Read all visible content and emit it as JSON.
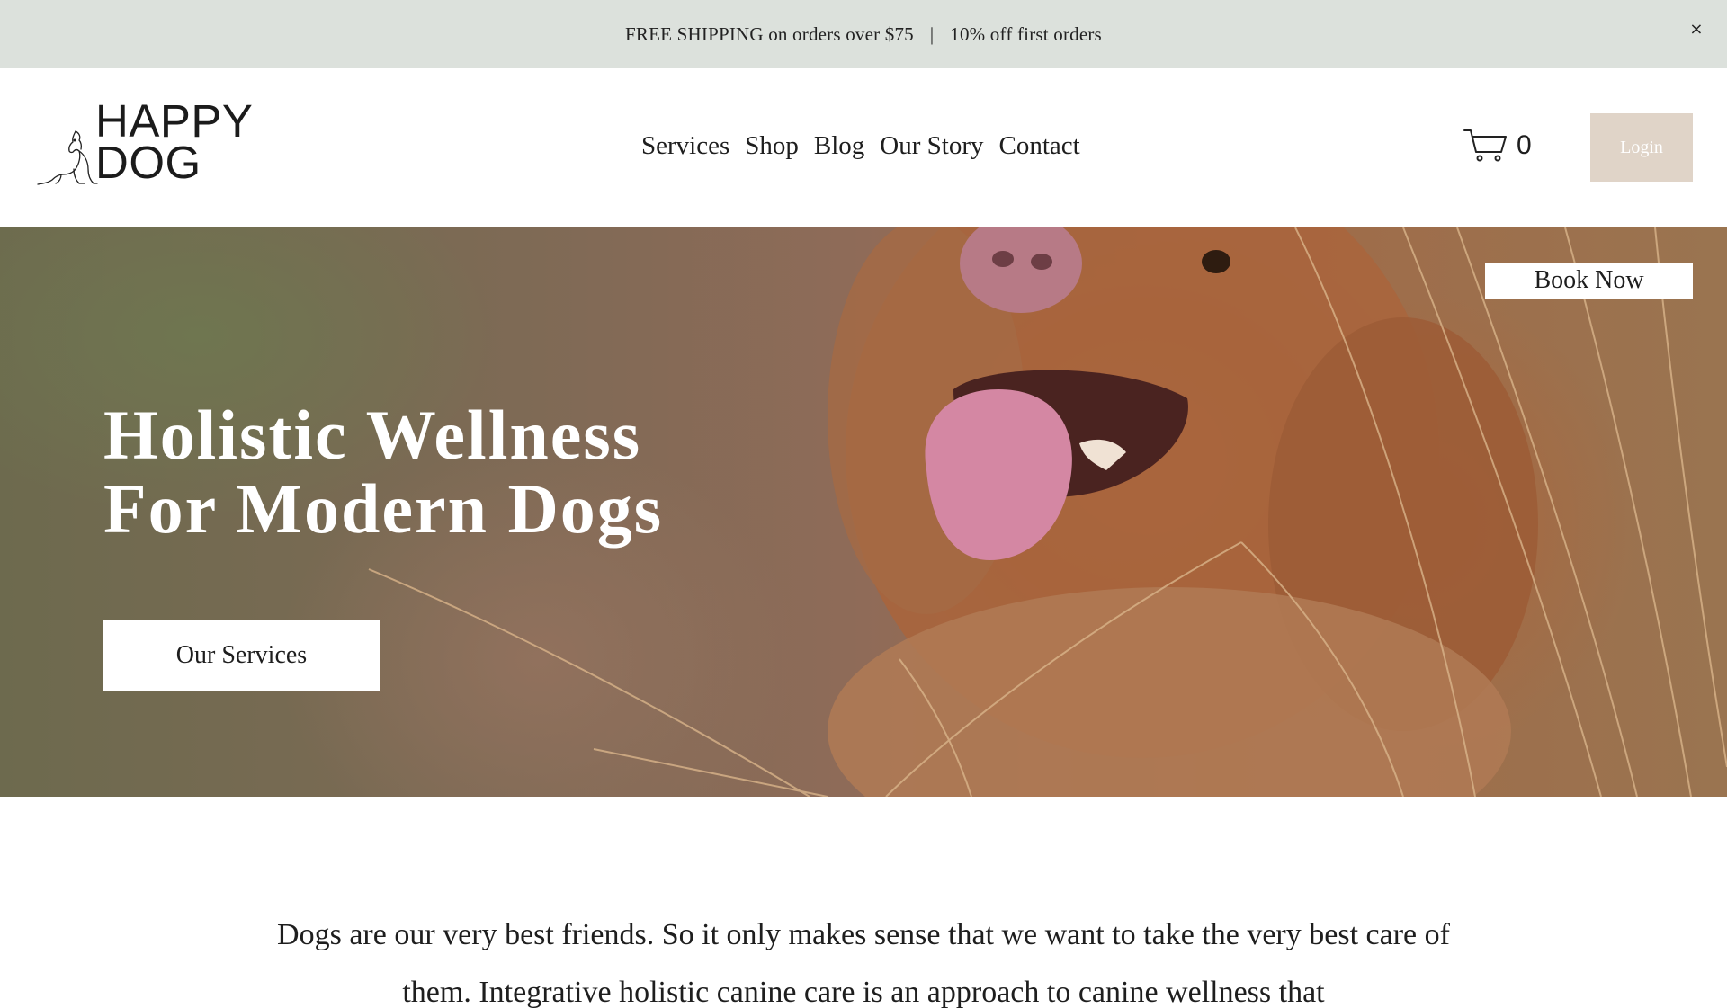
{
  "announcement": {
    "left": "FREE SHIPPING on orders over $75",
    "separator": "|",
    "right": "10% off first orders",
    "close_glyph": "×"
  },
  "header": {
    "logo_line1": "HAPPY",
    "logo_line2": "DOG",
    "nav": [
      "Services",
      "Shop",
      "Blog",
      "Our Story",
      "Contact"
    ],
    "cart_count": "0",
    "login_label": "Login"
  },
  "hero": {
    "title_line1": "Holistic Wellness",
    "title_line2": "For Modern Dogs",
    "cta_label": "Our Services",
    "book_label": "Book Now"
  },
  "intro": {
    "text": "Dogs are our very best friends. So it only makes sense that we want to take the very best care of them. Integrative holistic canine care is an approach to canine wellness that"
  },
  "colors": {
    "announcement_bg": "#dce1dc",
    "login_bg": "#e0d4c8",
    "accent_text": "#1e1e1e"
  },
  "icons": [
    "close-icon",
    "dog-logo-icon",
    "cart-icon"
  ]
}
